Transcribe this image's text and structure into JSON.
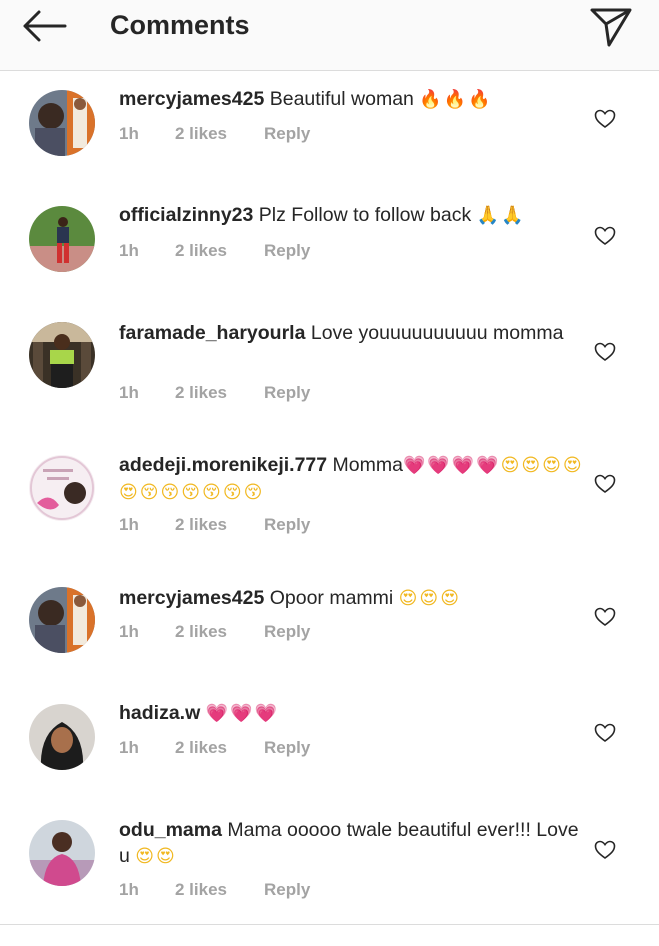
{
  "header": {
    "title": "Comments",
    "back_icon": "arrow-left-icon",
    "share_icon": "paper-plane-icon"
  },
  "colors": {
    "text": "#262626",
    "meta": "#a3a3a3",
    "divider": "#dcdcdc",
    "header_bg": "#fafafa",
    "heart_emoji": "#e0529c",
    "fire_emoji": "#f15a24"
  },
  "comments": [
    {
      "username": "mercyjames425",
      "text": "Beautiful woman",
      "emoji": "🔥🔥🔥",
      "time": "1h",
      "likes": "2 likes",
      "reply": "Reply"
    },
    {
      "username": "officialzinny23",
      "text": "Plz Follow to follow back",
      "emoji": "🙏🙏",
      "time": "1h",
      "likes": "2 likes",
      "reply": "Reply"
    },
    {
      "username": "faramade_haryourla",
      "text": "Love youuuuuuuuuu momma",
      "emoji": "",
      "time": "1h",
      "likes": "2 likes",
      "reply": "Reply"
    },
    {
      "username": "adedeji.morenikeji.777",
      "text": "Momma",
      "emoji_hearts": "💗💗💗💗",
      "emoji_faces": "😍😍😍😍😍",
      "emoji_kisses": "😚😚😚😚😚😚",
      "time": "1h",
      "likes": "2 likes",
      "reply": "Reply"
    },
    {
      "username": "mercyjames425",
      "text": "Opoor mammi",
      "emoji": "😍😍😍",
      "time": "1h",
      "likes": "2 likes",
      "reply": "Reply"
    },
    {
      "username": "hadiza.w",
      "text": "",
      "emoji": "💗💗💗",
      "time": "1h",
      "likes": "2 likes",
      "reply": "Reply"
    },
    {
      "username": "odu_mama",
      "text": "Mama ooooo twale beautiful ever!!! Love u",
      "emoji": "😍😍",
      "time": "1h",
      "likes": "2 likes",
      "reply": "Reply"
    }
  ]
}
